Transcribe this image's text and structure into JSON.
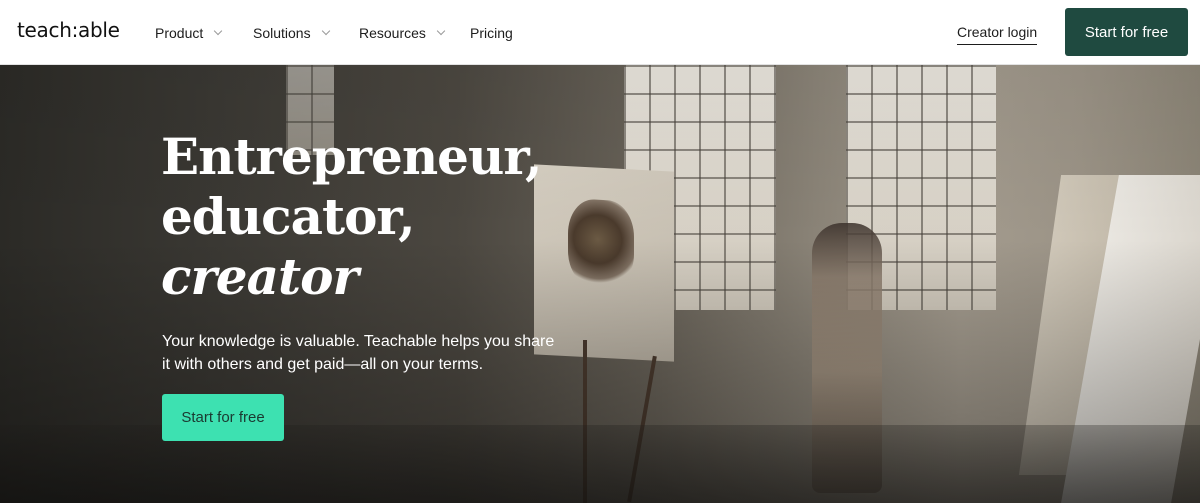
{
  "brand": {
    "logo_text": "teach:able",
    "accent": "#1f4a40",
    "cta_color": "#3de1b1"
  },
  "nav": {
    "items": [
      {
        "label": "Product",
        "dropdown": true
      },
      {
        "label": "Solutions",
        "dropdown": true
      },
      {
        "label": "Resources",
        "dropdown": true
      },
      {
        "label": "Pricing",
        "dropdown": false
      }
    ],
    "login_label": "Creator login",
    "cta_label": "Start for free"
  },
  "hero": {
    "headline_line1": "Entrepreneur,",
    "headline_line2": "educator,",
    "headline_line3": "creator",
    "subtitle": "Your knowledge is valuable. Teachable helps you share it with others and get paid—all on your terms.",
    "cta_label": "Start for free"
  }
}
